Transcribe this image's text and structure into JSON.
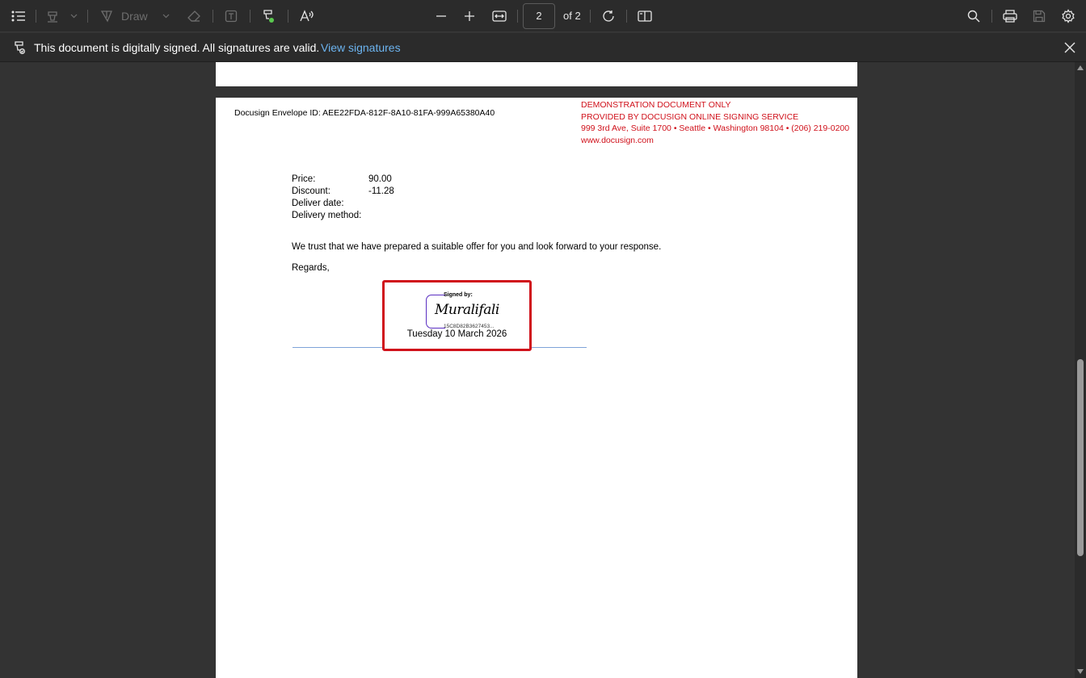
{
  "toolbar": {
    "draw_label": "Draw",
    "page_current": "2",
    "page_total": "of 2",
    "icons": [
      "contents-icon",
      "highlight-icon",
      "draw-icon",
      "erase-icon",
      "text-box-icon",
      "signature-icon",
      "read-aloud-icon",
      "zoom-out-icon",
      "zoom-in-icon",
      "fit-width-icon",
      "rotate-icon",
      "page-view-icon",
      "search-icon",
      "print-icon",
      "save-icon",
      "settings-icon"
    ]
  },
  "infobar": {
    "message": "This document is digitally signed. All signatures are valid.",
    "link": "View signatures"
  },
  "document": {
    "envelope_id": "Docusign Envelope ID: AEE22FDA-812F-8A10-81FA-999A65380A40",
    "demo_lines": [
      "DEMONSTRATION DOCUMENT ONLY",
      "PROVIDED BY DOCUSIGN ONLINE SIGNING SERVICE",
      "999 3rd Ave, Suite 1700  • Seattle • Washington 98104 • (206) 219-0200",
      "www.docusign.com"
    ],
    "fields": [
      {
        "label": "Price:",
        "value": "90.00"
      },
      {
        "label": "Discount:",
        "value": "-11.28"
      },
      {
        "label": "Deliver date:",
        "value": ""
      },
      {
        "label": "Delivery method:",
        "value": ""
      }
    ],
    "trust_text": "We trust that we have prepared a suitable offer for you and look forward to your response.",
    "regards": "Regards,",
    "signature": {
      "signed_by": "Signed by:",
      "name": "Muralifali",
      "hash": "15C8D82B3627453...",
      "date": "Tuesday 10 March 2026"
    }
  },
  "colors": {
    "toolbar_bg": "#2b2b2b",
    "viewer_bg": "#333333",
    "link": "#6cb4f0",
    "demo_red": "#d0111b",
    "signature_border": "#d0111b"
  }
}
